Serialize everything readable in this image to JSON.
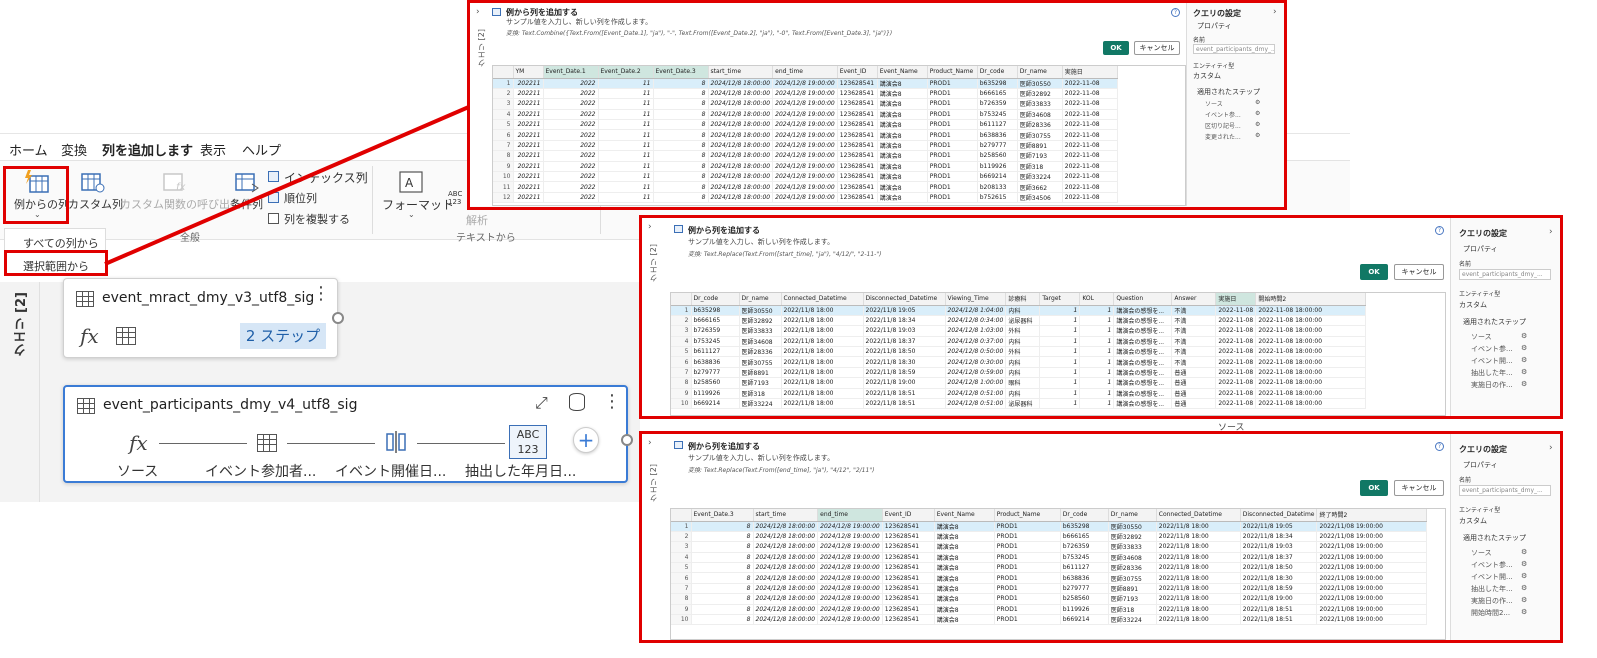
{
  "ribbon": {
    "tabs": [
      "ホーム",
      "変換",
      "列を追加します",
      "表示",
      "ヘルプ"
    ],
    "buttons": {
      "col_from_example": "例からの列",
      "custom_column": "カスタム列",
      "invoke_custom_function": "カスタム関数の呼び出し",
      "conditional": "条件列",
      "index_column": "インデックス列",
      "rank_column": "順位列",
      "duplicate_column": "列を複製する",
      "format": "フォーマット",
      "parse": "解析",
      "abc_icon": "ABC 123"
    },
    "groups": {
      "general": "全般",
      "from_text": "テキストから"
    },
    "dropdown": {
      "all_columns": "すべての列から",
      "from_selection": "選択範囲から"
    }
  },
  "queries_pane": {
    "label": "クエリ [2]",
    "card1": {
      "title": "event_mract_dmy_v3_utf8_sig",
      "steps_badge": "2 ステップ"
    },
    "card2": {
      "title": "event_participants_dmy_v4_utf8_sig",
      "steps": [
        "ソース",
        "イベント参加者...",
        "イベント開催日...",
        "抽出した年月日..."
      ],
      "abc_icon": "ABC 123"
    }
  },
  "common": {
    "panel_title": "例から列を追加する",
    "subtitle": "サンプル値を入力し、新しい列を作成します。",
    "ok": "OK",
    "cancel": "キャンセル",
    "vtab": "クエリ [2]",
    "settings_title": "クエリの設定",
    "properties": "プロパティ",
    "name_label": "名前",
    "name_value": "event_participants_dmy_...",
    "entity_label": "エンティティ型",
    "entity_value": "カスタム",
    "applied_steps": "適用されたステップ",
    "behind_step": "ソース"
  },
  "panel_top": {
    "transform": "変換: Text.Combine({Text.From([Event_Date.1], \"ja\"), \"-\", Text.From([Event_Date.2], \"ja\"), \"-0\", Text.From([Event_Date.3], \"ja\")})",
    "steps": [
      "ソース",
      "イベント参...",
      "区切り記号...",
      "変更された..."
    ],
    "columns": [
      "YM",
      "Event_Date.1",
      "Event_Date.2",
      "Event_Date.3",
      "start_time",
      "end_time",
      "Event_ID",
      "Event_Name",
      "Product_Name",
      "Dr_code",
      "Dr_name",
      "実施日"
    ],
    "rows": [
      [
        "202211",
        "2022",
        "11",
        "8",
        "2024/12/8 18:00:00",
        "2024/12/8 19:00:00",
        "123628541",
        "講演会8",
        "PROD1",
        "b635298",
        "医師30550",
        "2022-11-08"
      ],
      [
        "202211",
        "2022",
        "11",
        "8",
        "2024/12/8 18:00:00",
        "2024/12/8 19:00:00",
        "123628541",
        "講演会8",
        "PROD1",
        "b666165",
        "医師32892",
        "2022-11-08"
      ],
      [
        "202211",
        "2022",
        "11",
        "8",
        "2024/12/8 18:00:00",
        "2024/12/8 19:00:00",
        "123628541",
        "講演会8",
        "PROD1",
        "b726359",
        "医師33833",
        "2022-11-08"
      ],
      [
        "202211",
        "2022",
        "11",
        "8",
        "2024/12/8 18:00:00",
        "2024/12/8 19:00:00",
        "123628541",
        "講演会8",
        "PROD1",
        "b753245",
        "医師34608",
        "2022-11-08"
      ],
      [
        "202211",
        "2022",
        "11",
        "8",
        "2024/12/8 18:00:00",
        "2024/12/8 19:00:00",
        "123628541",
        "講演会8",
        "PROD1",
        "b611127",
        "医師28336",
        "2022-11-08"
      ],
      [
        "202211",
        "2022",
        "11",
        "8",
        "2024/12/8 18:00:00",
        "2024/12/8 19:00:00",
        "123628541",
        "講演会8",
        "PROD1",
        "b638836",
        "医師30755",
        "2022-11-08"
      ],
      [
        "202211",
        "2022",
        "11",
        "8",
        "2024/12/8 18:00:00",
        "2024/12/8 19:00:00",
        "123628541",
        "講演会8",
        "PROD1",
        "b279777",
        "医師8891",
        "2022-11-08"
      ],
      [
        "202211",
        "2022",
        "11",
        "8",
        "2024/12/8 18:00:00",
        "2024/12/8 19:00:00",
        "123628541",
        "講演会8",
        "PROD1",
        "b258560",
        "医師7193",
        "2022-11-08"
      ],
      [
        "202211",
        "2022",
        "11",
        "8",
        "2024/12/8 18:00:00",
        "2024/12/8 19:00:00",
        "123628541",
        "講演会8",
        "PROD1",
        "b119926",
        "医師318",
        "2022-11-08"
      ],
      [
        "202211",
        "2022",
        "11",
        "8",
        "2024/12/8 18:00:00",
        "2024/12/8 19:00:00",
        "123628541",
        "講演会8",
        "PROD1",
        "b669214",
        "医師33224",
        "2022-11-08"
      ],
      [
        "202211",
        "2022",
        "11",
        "8",
        "2024/12/8 18:00:00",
        "2024/12/8 19:00:00",
        "123628541",
        "講演会8",
        "PROD1",
        "b208133",
        "医師3662",
        "2022-11-08"
      ],
      [
        "202211",
        "2022",
        "11",
        "8",
        "2024/12/8 18:00:00",
        "2024/12/8 19:00:00",
        "123628541",
        "講演会8",
        "PROD1",
        "b752615",
        "医師34506",
        "2022-11-08"
      ]
    ]
  },
  "panel_mid": {
    "transform": "変換: Text.Replace(Text.From([start_time], \"ja\"), \"4/12/\", \"2-11-\")",
    "steps": [
      "ソース",
      "イベント参...",
      "イベント開...",
      "抽出した年...",
      "実施日の作..."
    ],
    "columns": [
      "Dr_code",
      "Dr_name",
      "Connected_Datetime",
      "Disconnected_Datetime",
      "Viewing_Time",
      "診療科",
      "Target",
      "KOL",
      "Question",
      "Answer",
      "実施日",
      "開始時間2"
    ],
    "rows": [
      [
        "b635298",
        "医師30550",
        "2022/11/8 18:00",
        "2022/11/8 19:05",
        "2024/12/8 1:04:00",
        "内科",
        "1",
        "1",
        "講演会の感想を...",
        "不満",
        "2022-11-08",
        "2022-11-08 18:00:00"
      ],
      [
        "b666165",
        "医師32892",
        "2022/11/8 18:00",
        "2022/11/8 18:34",
        "2024/12/8 0:34:00",
        "泌尿器科",
        "1",
        "1",
        "講演会の感想を...",
        "不満",
        "2022-11-08",
        "2022-11-08 18:00:00"
      ],
      [
        "b726359",
        "医師33833",
        "2022/11/8 18:00",
        "2022/11/8 19:03",
        "2024/12/8 1:03:00",
        "外科",
        "1",
        "1",
        "講演会の感想を...",
        "不満",
        "2022-11-08",
        "2022-11-08 18:00:00"
      ],
      [
        "b753245",
        "医師34608",
        "2022/11/8 18:00",
        "2022/11/8 18:37",
        "2024/12/8 0:37:00",
        "内科",
        "1",
        "1",
        "講演会の感想を...",
        "不満",
        "2022-11-08",
        "2022-11-08 18:00:00"
      ],
      [
        "b611127",
        "医師28336",
        "2022/11/8 18:00",
        "2022/11/8 18:50",
        "2024/12/8 0:50:00",
        "外科",
        "1",
        "1",
        "講演会の感想を...",
        "不満",
        "2022-11-08",
        "2022-11-08 18:00:00"
      ],
      [
        "b638836",
        "医師30755",
        "2022/11/8 18:00",
        "2022/11/8 18:30",
        "2024/12/8 0:30:00",
        "内科",
        "1",
        "1",
        "講演会の感想を...",
        "不満",
        "2022-11-08",
        "2022-11-08 18:00:00"
      ],
      [
        "b279777",
        "医師8891",
        "2022/11/8 18:00",
        "2022/11/8 18:59",
        "2024/12/8 0:59:00",
        "内科",
        "1",
        "1",
        "講演会の感想を...",
        "普通",
        "2022-11-08",
        "2022-11-08 18:00:00"
      ],
      [
        "b258560",
        "医師7193",
        "2022/11/8 18:00",
        "2022/11/8 19:00",
        "2024/12/8 1:00:00",
        "眼科",
        "1",
        "1",
        "講演会の感想を...",
        "普通",
        "2022-11-08",
        "2022-11-08 18:00:00"
      ],
      [
        "b119926",
        "医師318",
        "2022/11/8 18:00",
        "2022/11/8 18:51",
        "2024/12/8 0:51:00",
        "内科",
        "1",
        "1",
        "講演会の感想を...",
        "普通",
        "2022-11-08",
        "2022-11-08 18:00:00"
      ],
      [
        "b669214",
        "医師33224",
        "2022/11/8 18:00",
        "2022/11/8 18:51",
        "2024/12/8 0:51:00",
        "泌尿器科",
        "1",
        "1",
        "講演会の感想を...",
        "普通",
        "2022-11-08",
        "2022-11-08 18:00:00"
      ]
    ]
  },
  "panel_bot": {
    "transform": "変換: Text.Replace(Text.From([end_time], \"ja\"), \"4/12\", \"2/11\")",
    "steps": [
      "ソース",
      "イベント参...",
      "イベント開...",
      "抽出した年...",
      "実施日の作...",
      "開始時間2..."
    ],
    "columns": [
      "Event_Date.3",
      "start_time",
      "end_time",
      "Event_ID",
      "Event_Name",
      "Product_Name",
      "Dr_code",
      "Dr_name",
      "Connected_Datetime",
      "Disconnected_Datetime",
      "終了時間2"
    ],
    "rows": [
      [
        "8",
        "2024/12/8 18:00:00",
        "2024/12/8 19:00:00",
        "123628541",
        "講演会8",
        "PROD1",
        "b635298",
        "医師30550",
        "2022/11/8 18:00",
        "2022/11/8 19:05",
        "2022/11/08 19:00:00"
      ],
      [
        "8",
        "2024/12/8 18:00:00",
        "2024/12/8 19:00:00",
        "123628541",
        "講演会8",
        "PROD1",
        "b666165",
        "医師32892",
        "2022/11/8 18:00",
        "2022/11/8 18:34",
        "2022/11/08 19:00:00"
      ],
      [
        "8",
        "2024/12/8 18:00:00",
        "2024/12/8 19:00:00",
        "123628541",
        "講演会8",
        "PROD1",
        "b726359",
        "医師33833",
        "2022/11/8 18:00",
        "2022/11/8 19:03",
        "2022/11/08 19:00:00"
      ],
      [
        "8",
        "2024/12/8 18:00:00",
        "2024/12/8 19:00:00",
        "123628541",
        "講演会8",
        "PROD1",
        "b753245",
        "医師34608",
        "2022/11/8 18:00",
        "2022/11/8 18:37",
        "2022/11/08 19:00:00"
      ],
      [
        "8",
        "2024/12/8 18:00:00",
        "2024/12/8 19:00:00",
        "123628541",
        "講演会8",
        "PROD1",
        "b611127",
        "医師28336",
        "2022/11/8 18:00",
        "2022/11/8 18:50",
        "2022/11/08 19:00:00"
      ],
      [
        "8",
        "2024/12/8 18:00:00",
        "2024/12/8 19:00:00",
        "123628541",
        "講演会8",
        "PROD1",
        "b638836",
        "医師30755",
        "2022/11/8 18:00",
        "2022/11/8 18:30",
        "2022/11/08 19:00:00"
      ],
      [
        "8",
        "2024/12/8 18:00:00",
        "2024/12/8 19:00:00",
        "123628541",
        "講演会8",
        "PROD1",
        "b279777",
        "医師8891",
        "2022/11/8 18:00",
        "2022/11/8 18:59",
        "2022/11/08 19:00:00"
      ],
      [
        "8",
        "2024/12/8 18:00:00",
        "2024/12/8 19:00:00",
        "123628541",
        "講演会8",
        "PROD1",
        "b258560",
        "医師7193",
        "2022/11/8 18:00",
        "2022/11/8 19:00",
        "2022/11/08 19:00:00"
      ],
      [
        "8",
        "2024/12/8 18:00:00",
        "2024/12/8 19:00:00",
        "123628541",
        "講演会8",
        "PROD1",
        "b119926",
        "医師318",
        "2022/11/8 18:00",
        "2022/11/8 18:51",
        "2022/11/08 19:00:00"
      ],
      [
        "8",
        "2024/12/8 18:00:00",
        "2024/12/8 19:00:00",
        "123628541",
        "講演会8",
        "PROD1",
        "b669214",
        "医師33224",
        "2022/11/8 18:00",
        "2022/11/8 18:51",
        "2022/11/08 19:00:00"
      ]
    ]
  },
  "colors": {
    "highlight": "#e00000",
    "ok": "#117865",
    "selected_card": "#3a7bd5"
  }
}
